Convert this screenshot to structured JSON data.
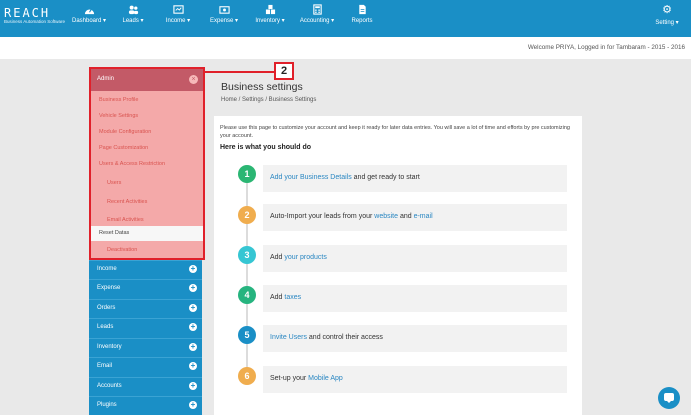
{
  "brand": {
    "name": "REACH",
    "tagline": "Business Automation Software"
  },
  "nav": [
    {
      "label": "Dashboard ▾",
      "icon": "dashboard-icon"
    },
    {
      "label": "Leads ▾",
      "icon": "users-icon"
    },
    {
      "label": "Income ▾",
      "icon": "income-icon"
    },
    {
      "label": "Expense ▾",
      "icon": "expense-icon"
    },
    {
      "label": "Inventory ▾",
      "icon": "inventory-icon"
    },
    {
      "label": "Accounting ▾",
      "icon": "calculator-icon"
    },
    {
      "label": "Reports",
      "icon": "reports-icon"
    },
    {
      "label": "Setting ▾",
      "icon": "gear-icon"
    }
  ],
  "welcome": "Welcome PRIYA, Logged in for Tambaram - 2015 - 2016",
  "sidebar": {
    "admin": {
      "label": "Admin",
      "close_icon": "close-icon",
      "items": [
        "Business Profile",
        "Vehicle Settings",
        "Module Configuration",
        "Page Customization",
        "Users & Access Restriction",
        "Users",
        "Recent Activities",
        "Email Activities",
        "Reset Datas",
        "Deactivation"
      ],
      "active_index": 8
    },
    "items": [
      "Income",
      "Expense",
      "Orders",
      "Leads",
      "Inventory",
      "Email",
      "Accounts",
      "Plugins"
    ]
  },
  "callout": "2",
  "page": {
    "title": "Business settings",
    "breadcrumb": "Home / Settings / Business Settings",
    "intro": "Please use this page to customize your account and keep it ready for later data entries. You will save a lot of time and efforts by pre customizing your account.",
    "subhead": "Here is what you should do"
  },
  "steps": [
    {
      "num": "1",
      "color": "#2bb673",
      "link": "Add your Business Details",
      "rest": " and get ready to start"
    },
    {
      "num": "2",
      "color": "#f0ad4e",
      "pre": "Auto-Import your leads from your ",
      "link": "website",
      "mid": " and ",
      "link2": "e-mail"
    },
    {
      "num": "3",
      "color": "#36c6d3",
      "pre": "Add ",
      "link": "your products"
    },
    {
      "num": "4",
      "color": "#26b47f",
      "pre": "Add ",
      "link": "taxes"
    },
    {
      "num": "5",
      "color": "#1a8fc6",
      "link": "Invite Users",
      "rest": " and control their access"
    },
    {
      "num": "6",
      "color": "#f0ad4e",
      "pre": "Set-up your ",
      "link": "Mobile App"
    }
  ],
  "chat_icon": "chat-icon"
}
